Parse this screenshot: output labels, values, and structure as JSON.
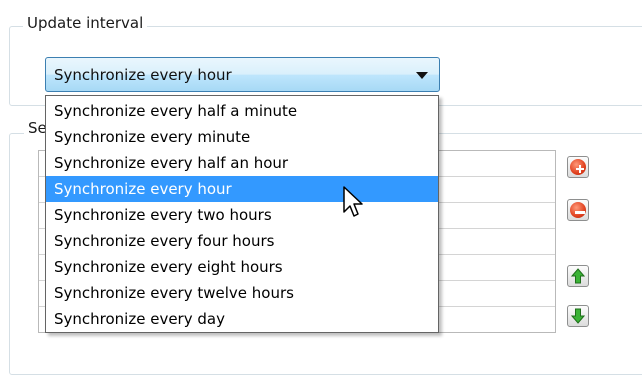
{
  "update_group": {
    "title": "Update interval"
  },
  "servers_group": {
    "title": "Se"
  },
  "combo": {
    "selected_value": "Synchronize every hour"
  },
  "dropdown": {
    "selected_index": 3,
    "options": [
      "Synchronize every half a minute",
      "Synchronize every minute",
      "Synchronize every half an hour",
      "Synchronize every hour",
      "Synchronize every two hours",
      "Synchronize every four hours",
      "Synchronize every eight hours",
      "Synchronize every twelve hours",
      "Synchronize every day"
    ]
  },
  "side_buttons": {
    "add_icon": "red-plus-icon",
    "remove_icon": "red-minus-icon",
    "up_icon": "green-up-arrow-icon",
    "down_icon": "green-down-arrow-icon"
  },
  "colors": {
    "selection": "#3399ff",
    "accent_red": "#e0401e",
    "accent_green": "#2f9e2a"
  }
}
